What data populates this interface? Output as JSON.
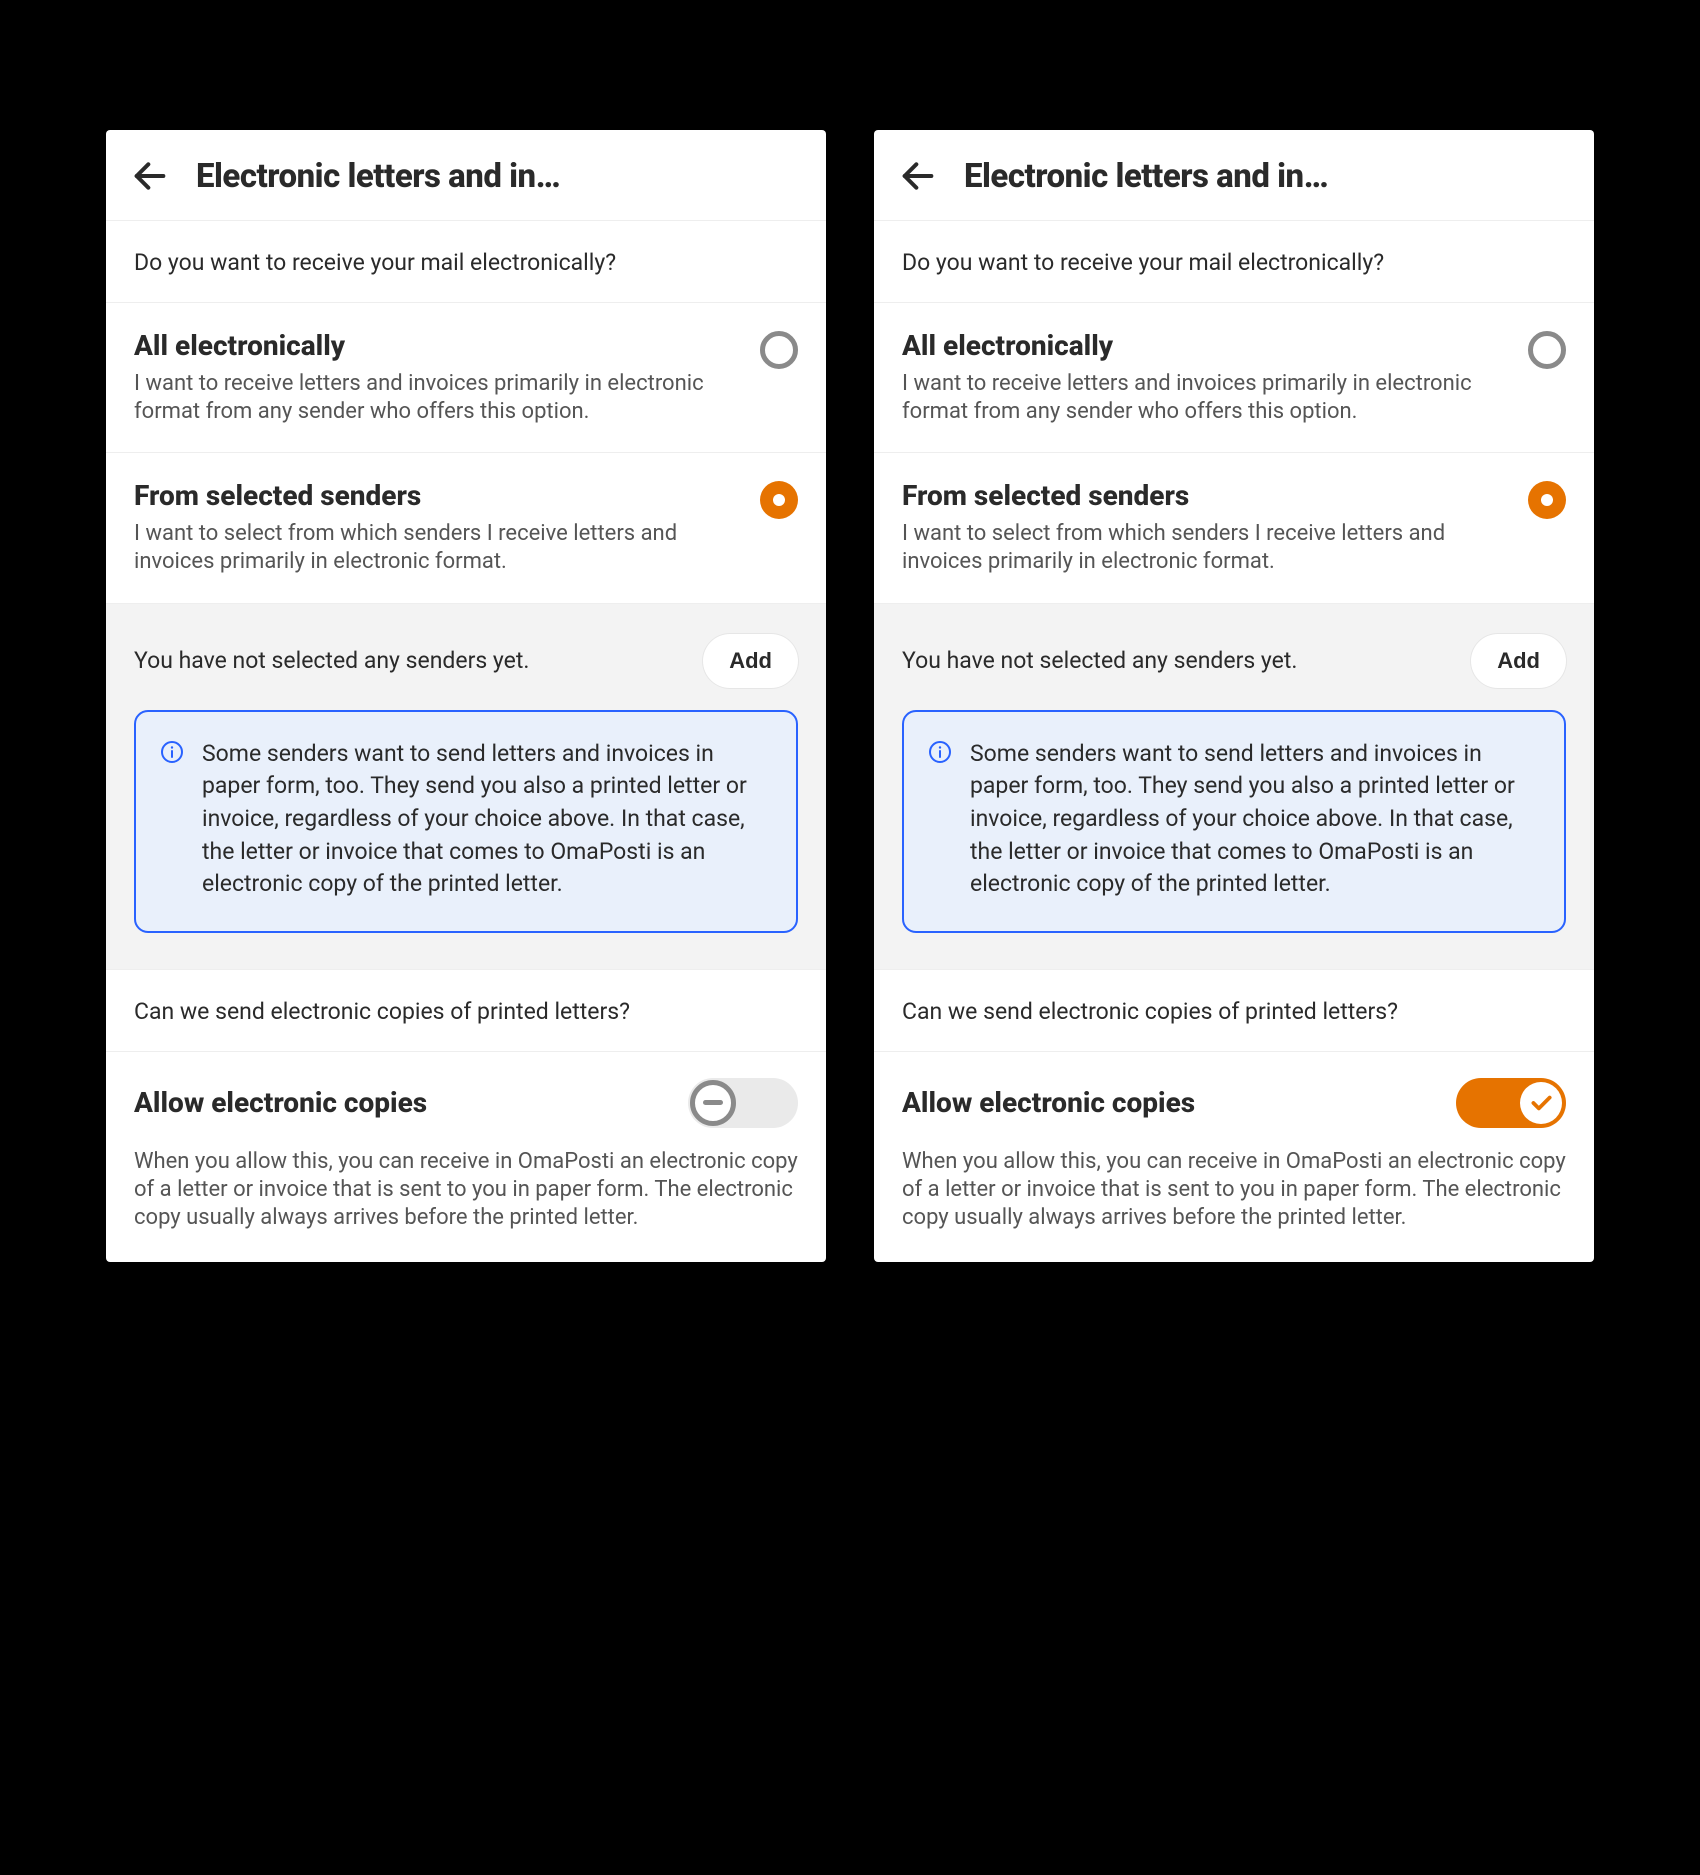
{
  "colors": {
    "accent": "#e67300",
    "infoBorder": "#2962ff",
    "infoBg": "#e9f0fb"
  },
  "header": {
    "title": "Electronic letters and in…"
  },
  "question1": "Do you want to receive your mail electronically?",
  "options": {
    "all": {
      "title": "All electronically",
      "desc": "I want to receive letters and invoices primarily in electronic format from any sender who offers this option.",
      "selected": false
    },
    "selected_senders": {
      "title": "From selected senders",
      "desc": "I want to select from which senders I receive letters and invoices primarily in electronic format.",
      "selected": true
    }
  },
  "senders_panel": {
    "empty_text": "You have not selected any senders yet.",
    "add_label": "Add",
    "info": "Some senders want to send letters and invoices in paper form, too. They send you also a printed letter or invoice, regardless of your choice above. In that case, the letter or invoice that comes to OmaPosti is an electronic copy of the printed letter."
  },
  "question2": "Can we send electronic copies of printed letters?",
  "allow_copies": {
    "title": "Allow electronic copies",
    "desc": "When you allow this, you can receive in OmaPosti an electronic copy of a letter or invoice that is sent to you in paper form. The electronic copy usually always arrives before the printed letter."
  },
  "screens": [
    {
      "allow_copies_enabled": false
    },
    {
      "allow_copies_enabled": true
    }
  ]
}
